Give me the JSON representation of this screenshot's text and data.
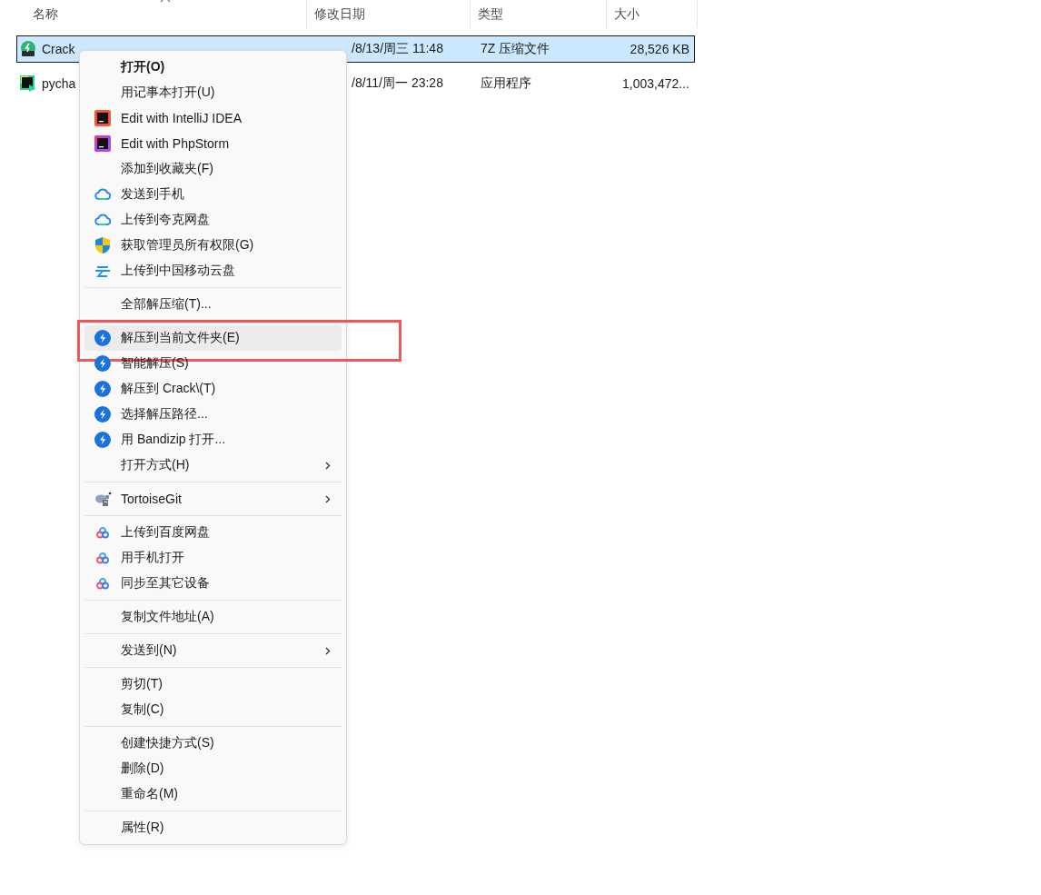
{
  "columns": [
    {
      "label": "名称",
      "sorted": true
    },
    {
      "label": "修改日期",
      "sorted": false
    },
    {
      "label": "类型",
      "sorted": false
    },
    {
      "label": "大小",
      "sorted": false
    }
  ],
  "files": [
    {
      "name": "Crack",
      "modified": "/8/13/周三 11:48",
      "type": "7Z 压缩文件",
      "size": "28,526 KB",
      "selected": true
    },
    {
      "name": "pycha",
      "modified": "/8/11/周一 23:28",
      "type": "应用程序",
      "size": "1,003,472...",
      "selected": false
    }
  ],
  "context_menu": {
    "items": [
      {
        "kind": "item",
        "label": "打开(O)",
        "default": true,
        "selected": false,
        "submenu": false
      },
      {
        "kind": "item",
        "label": "用记事本打开(U)",
        "default": false,
        "selected": false,
        "submenu": false
      },
      {
        "kind": "item",
        "label": "Edit with IntelliJ IDEA",
        "default": false,
        "selected": false,
        "submenu": false
      },
      {
        "kind": "item",
        "label": "Edit with PhpStorm",
        "default": false,
        "selected": false,
        "submenu": false
      },
      {
        "kind": "item",
        "label": "添加到收藏夹(F)",
        "default": false,
        "selected": false,
        "submenu": false
      },
      {
        "kind": "item",
        "label": "发送到手机",
        "default": false,
        "selected": false,
        "submenu": false
      },
      {
        "kind": "item",
        "label": "上传到夸克网盘",
        "default": false,
        "selected": false,
        "submenu": false
      },
      {
        "kind": "item",
        "label": "获取管理员所有权限(G)",
        "default": false,
        "selected": false,
        "submenu": false
      },
      {
        "kind": "item",
        "label": "上传到中国移动云盘",
        "default": false,
        "selected": false,
        "submenu": false
      },
      {
        "kind": "separator"
      },
      {
        "kind": "item",
        "label": "全部解压缩(T)...",
        "default": false,
        "selected": false,
        "submenu": false
      },
      {
        "kind": "separator"
      },
      {
        "kind": "item",
        "label": "解压到当前文件夹(E)",
        "default": false,
        "selected": true,
        "submenu": false,
        "highlighted": true
      },
      {
        "kind": "item",
        "label": "智能解压(S)",
        "default": false,
        "selected": false,
        "submenu": false
      },
      {
        "kind": "item",
        "label": "解压到 Crack\\(T)",
        "default": false,
        "selected": false,
        "submenu": false
      },
      {
        "kind": "item",
        "label": "选择解压路径...",
        "default": false,
        "selected": false,
        "submenu": false
      },
      {
        "kind": "item",
        "label": "用 Bandizip 打开...",
        "default": false,
        "selected": false,
        "submenu": false
      },
      {
        "kind": "item",
        "label": "打开方式(H)",
        "default": false,
        "selected": false,
        "submenu": true
      },
      {
        "kind": "separator"
      },
      {
        "kind": "item",
        "label": "TortoiseGit",
        "default": false,
        "selected": false,
        "submenu": true
      },
      {
        "kind": "separator"
      },
      {
        "kind": "item",
        "label": "上传到百度网盘",
        "default": false,
        "selected": false,
        "submenu": false
      },
      {
        "kind": "item",
        "label": "用手机打开",
        "default": false,
        "selected": false,
        "submenu": false
      },
      {
        "kind": "item",
        "label": "同步至其它设备",
        "default": false,
        "selected": false,
        "submenu": false
      },
      {
        "kind": "separator"
      },
      {
        "kind": "item",
        "label": "复制文件地址(A)",
        "default": false,
        "selected": false,
        "submenu": false
      },
      {
        "kind": "separator"
      },
      {
        "kind": "item",
        "label": "发送到(N)",
        "default": false,
        "selected": false,
        "submenu": true
      },
      {
        "kind": "separator"
      },
      {
        "kind": "item",
        "label": "剪切(T)",
        "default": false,
        "selected": false,
        "submenu": false
      },
      {
        "kind": "item",
        "label": "复制(C)",
        "default": false,
        "selected": false,
        "submenu": false
      },
      {
        "kind": "separator"
      },
      {
        "kind": "item",
        "label": "创建快捷方式(S)",
        "default": false,
        "selected": false,
        "submenu": false
      },
      {
        "kind": "item",
        "label": "删除(D)",
        "default": false,
        "selected": false,
        "submenu": false
      },
      {
        "kind": "item",
        "label": "重命名(M)",
        "default": false,
        "selected": false,
        "submenu": false
      },
      {
        "kind": "separator"
      },
      {
        "kind": "item",
        "label": "属性(R)",
        "default": false,
        "selected": false,
        "submenu": false
      }
    ]
  }
}
